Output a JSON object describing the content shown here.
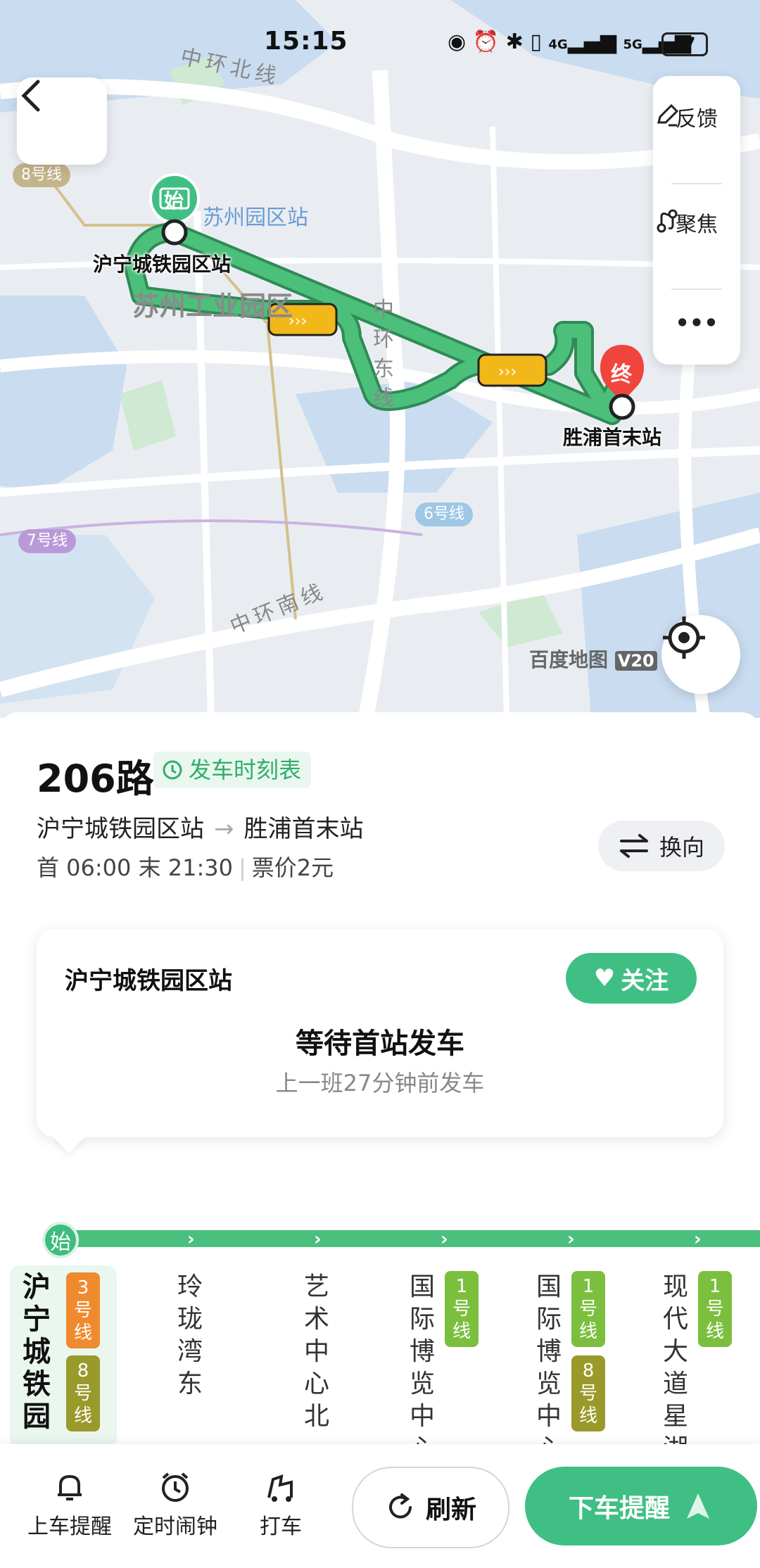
{
  "status_bar": {
    "time": "15:15",
    "battery": "47",
    "network1": "4G",
    "network2": "5G"
  },
  "map": {
    "roads": {
      "north": "中环北线",
      "east": "中环东线",
      "south": "中环南线"
    },
    "districts": {
      "park_station": "苏州园区站",
      "industrial_park": "苏州工业园区"
    },
    "metro_tags": {
      "line8": "8号线",
      "line6": "6号线",
      "line7": "7号线"
    },
    "start_stop": "沪宁城铁园区站",
    "end_stop": "胜浦首末站",
    "start_marker": "始",
    "end_marker": "终",
    "brand": "百度地图",
    "brand_version": "V20",
    "tools": {
      "feedback": "反馈",
      "focus": "聚焦",
      "more": "•••"
    }
  },
  "route": {
    "number": "206路",
    "timetable_label": "发车时刻表",
    "from": "沪宁城铁园区站",
    "to": "胜浦首末站",
    "arrow": "→",
    "first": "首 06:00",
    "last": "末 21:30",
    "fare": "票价2元",
    "swap_label": "换向"
  },
  "card": {
    "station": "沪宁城铁园区站",
    "follow_label": "关注",
    "status": "等待首站发车",
    "last_departure": "上一班27分钟前发车"
  },
  "stations": [
    {
      "name": "沪宁城铁园",
      "lines": [
        "3号线",
        "8号线"
      ],
      "current": true
    },
    {
      "name": "玲珑湾东",
      "lines": []
    },
    {
      "name": "艺术中心北",
      "lines": []
    },
    {
      "name": "国际博览中心",
      "lines": [
        "1号线"
      ]
    },
    {
      "name": "国际博览中心",
      "lines": [
        "1号线",
        "8号线"
      ]
    },
    {
      "name": "现代大道星湖",
      "lines": [
        "1号线"
      ]
    }
  ],
  "start_badge": "始",
  "bottom_bar": {
    "boarding_alert": "上车提醒",
    "timer_alarm": "定时闹钟",
    "taxi": "打车",
    "refresh": "刷新",
    "alighting_alert": "下车提醒"
  },
  "colors": {
    "accent": "#3fbf84",
    "route": "#49c07e",
    "line3": "#f08a2e",
    "line8": "#9a9a2b",
    "line1": "#7cbf3f",
    "end_red": "#f0453d"
  }
}
